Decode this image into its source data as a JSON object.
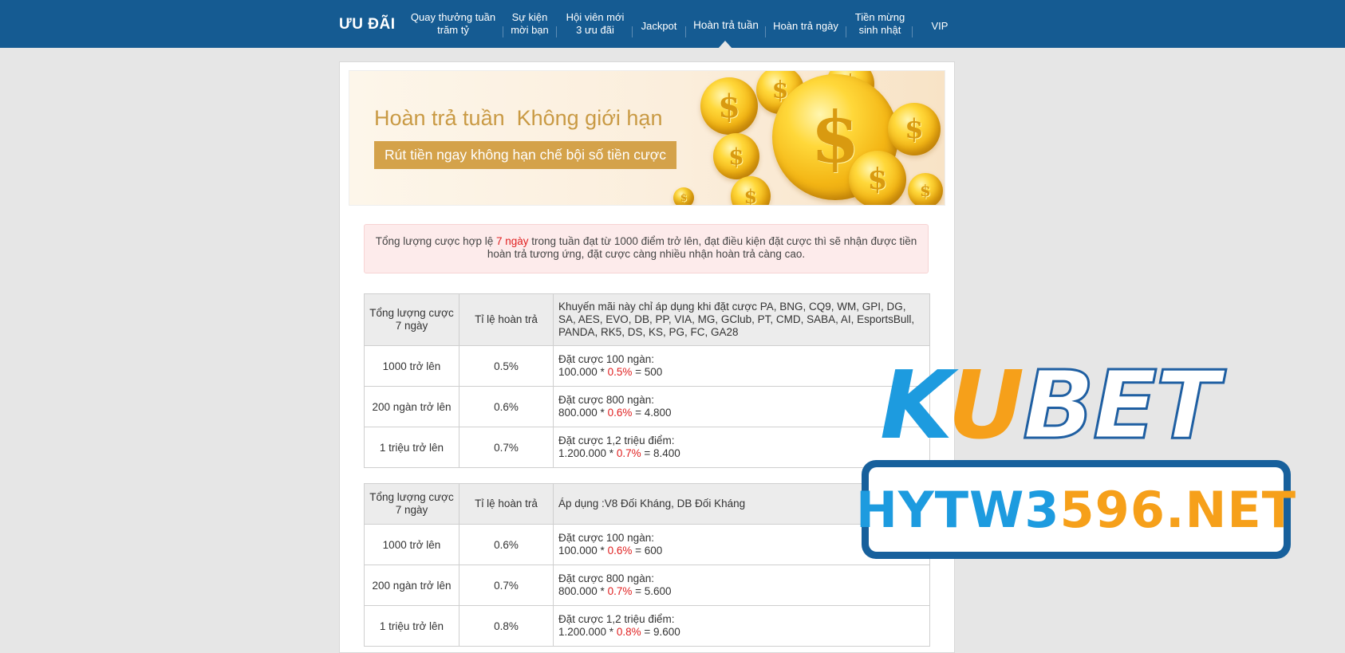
{
  "nav": {
    "brand": "ƯU ĐÃI",
    "items": [
      {
        "line1": "Quay thưởng tuần",
        "line2": "trăm tỷ"
      },
      {
        "line1": "Sự kiện",
        "line2": "mời bạn"
      },
      {
        "line1": "Hội viên mới",
        "line2": "3 ưu đãi"
      },
      {
        "line1": "Jackpot",
        "line2": ""
      },
      {
        "line1": "Hoàn trả tuần",
        "line2": ""
      },
      {
        "line1": "Hoàn trả ngày",
        "line2": ""
      },
      {
        "line1": "Tiền mừng",
        "line2": "sinh nhật"
      },
      {
        "line1": "VIP",
        "line2": ""
      }
    ],
    "active_index": 4
  },
  "banner": {
    "title": "Hoàn trả tuần  Không giới hạn",
    "subtitle": "Rút tiền ngay không hạn chế bội số tiền cược"
  },
  "notice": {
    "part1": "Tổng lượng cược hợp lệ ",
    "highlight": "7 ngày",
    "part2": " trong tuần đạt từ 1000 điểm trở lên, đạt điều kiện đặt cược thì sẽ nhận được tiền hoàn trả tương ứng, đặt cược càng nhiều nhận hoàn trả càng cao."
  },
  "tables": [
    {
      "header": {
        "col1": "Tổng lượng cược 7 ngày",
        "col2": "Tỉ lệ hoàn trả",
        "col3": "Khuyến mãi này chỉ áp dụng khi đặt cược PA, BNG, CQ9, WM, GPI, DG, SA, AES, EVO, DB, PP, VIA, MG, GClub, PT, CMD, SABA, AI, EsportsBull, PANDA, RK5, DS, KS, PG, FC, GA28"
      },
      "rows": [
        {
          "tier": "1000 trở lên",
          "rate": "0.5%",
          "ex_title": "Đặt cược 100 ngàn:",
          "ex_base": "100.000 * ",
          "ex_rate": "0.5%",
          "ex_result": " = 500"
        },
        {
          "tier": "200 ngàn trở lên",
          "rate": "0.6%",
          "ex_title": "Đặt cược 800 ngàn:",
          "ex_base": "800.000 * ",
          "ex_rate": "0.6%",
          "ex_result": " = 4.800"
        },
        {
          "tier": "1 triệu trở lên",
          "rate": "0.7%",
          "ex_title": "Đặt cược 1,2 triệu điểm:",
          "ex_base": "1.200.000 * ",
          "ex_rate": "0.7%",
          "ex_result": " = 8.400"
        }
      ]
    },
    {
      "header": {
        "col1": "Tổng lượng cược 7 ngày",
        "col2": "Tỉ lệ hoàn trả",
        "col3": "Áp dụng :V8 Đối Kháng, DB Đối Kháng"
      },
      "rows": [
        {
          "tier": "1000 trở lên",
          "rate": "0.6%",
          "ex_title": "Đặt cược 100 ngàn:",
          "ex_base": "100.000 * ",
          "ex_rate": "0.6%",
          "ex_result": " = 600"
        },
        {
          "tier": "200 ngàn trở lên",
          "rate": "0.7%",
          "ex_title": "Đặt cược 800 ngàn:",
          "ex_base": "800.000 * ",
          "ex_rate": "0.7%",
          "ex_result": " = 5.600"
        },
        {
          "tier": "1 triệu trở lên",
          "rate": "0.8%",
          "ex_title": "Đặt cược 1,2 triệu điểm:",
          "ex_base": "1.200.000 * ",
          "ex_rate": "0.8%",
          "ex_result": " = 9.600"
        }
      ]
    }
  ],
  "watermark": {
    "logo_k": "K",
    "logo_u": "U",
    "logo_bet": "BET",
    "domain_blue": "HYTW3",
    "domain_orange": "596.NET"
  },
  "colors": {
    "nav_bg": "#155b92",
    "highlight_red": "#e02020",
    "banner_gold": "#d4a24a",
    "logo_blue": "#1d9bdf",
    "logo_orange": "#f6a01a"
  }
}
